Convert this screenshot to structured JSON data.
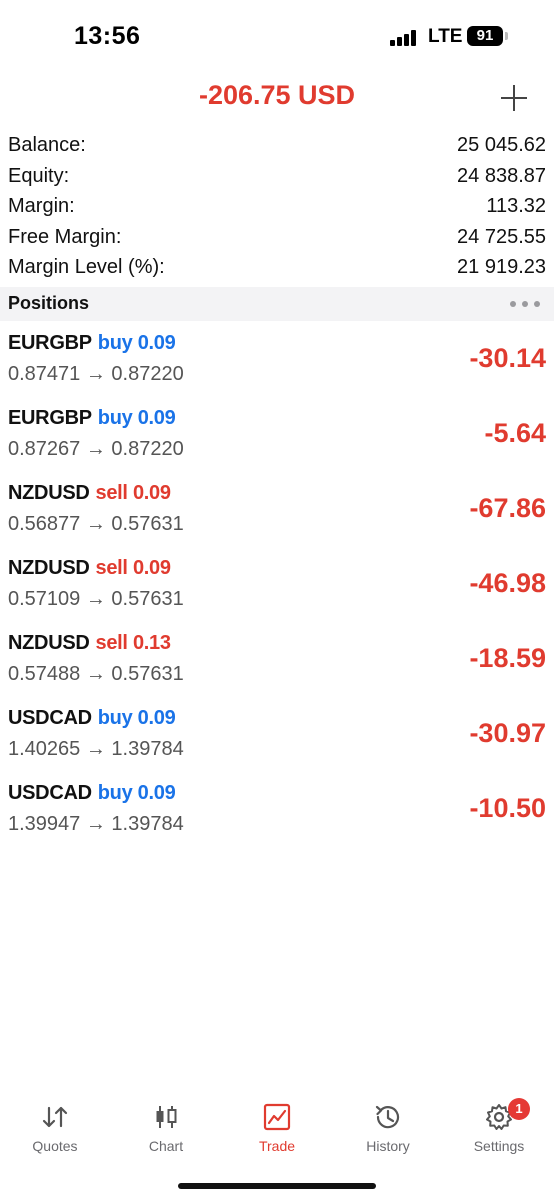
{
  "status_bar": {
    "time": "13:56",
    "network": "LTE",
    "battery": "91"
  },
  "header": {
    "title": "-206.75 USD",
    "add_icon": "plus-icon"
  },
  "summary": [
    {
      "label": "Balance:",
      "value": "25 045.62"
    },
    {
      "label": "Equity:",
      "value": "24 838.87"
    },
    {
      "label": "Margin:",
      "value": "113.32"
    },
    {
      "label": "Free Margin:",
      "value": "24 725.55"
    },
    {
      "label": "Margin Level (%):",
      "value": "21 919.23"
    }
  ],
  "positions_header": {
    "title": "Positions",
    "more_icon": "more-icon"
  },
  "positions": [
    {
      "symbol": "EURGBP",
      "direction": "buy 0.09",
      "side": "buy",
      "prices": "0.87471 → 0.87220",
      "profit": "-30.14"
    },
    {
      "symbol": "EURGBP",
      "direction": "buy 0.09",
      "side": "buy",
      "prices": "0.87267 → 0.87220",
      "profit": "-5.64"
    },
    {
      "symbol": "NZDUSD",
      "direction": "sell 0.09",
      "side": "sell",
      "prices": "0.56877 → 0.57631",
      "profit": "-67.86"
    },
    {
      "symbol": "NZDUSD",
      "direction": "sell 0.09",
      "side": "sell",
      "prices": "0.57109 → 0.57631",
      "profit": "-46.98"
    },
    {
      "symbol": "NZDUSD",
      "direction": "sell 0.13",
      "side": "sell",
      "prices": "0.57488 → 0.57631",
      "profit": "-18.59"
    },
    {
      "symbol": "USDCAD",
      "direction": "buy 0.09",
      "side": "buy",
      "prices": "1.40265 → 1.39784",
      "profit": "-30.97"
    },
    {
      "symbol": "USDCAD",
      "direction": "buy 0.09",
      "side": "buy",
      "prices": "1.39947 → 1.39784",
      "profit": "-10.50"
    }
  ],
  "tabs": [
    {
      "label": "Quotes",
      "icon": "quotes-icon",
      "active": false
    },
    {
      "label": "Chart",
      "icon": "chart-icon",
      "active": false
    },
    {
      "label": "Trade",
      "icon": "trade-icon",
      "active": true
    },
    {
      "label": "History",
      "icon": "history-icon",
      "active": false
    },
    {
      "label": "Settings",
      "icon": "settings-icon",
      "active": false,
      "badge": "1"
    }
  ],
  "colors": {
    "loss": "#e03b2f",
    "buy": "#1a73e8",
    "sell": "#e03b2f",
    "active_tab": "#e03b2f"
  }
}
